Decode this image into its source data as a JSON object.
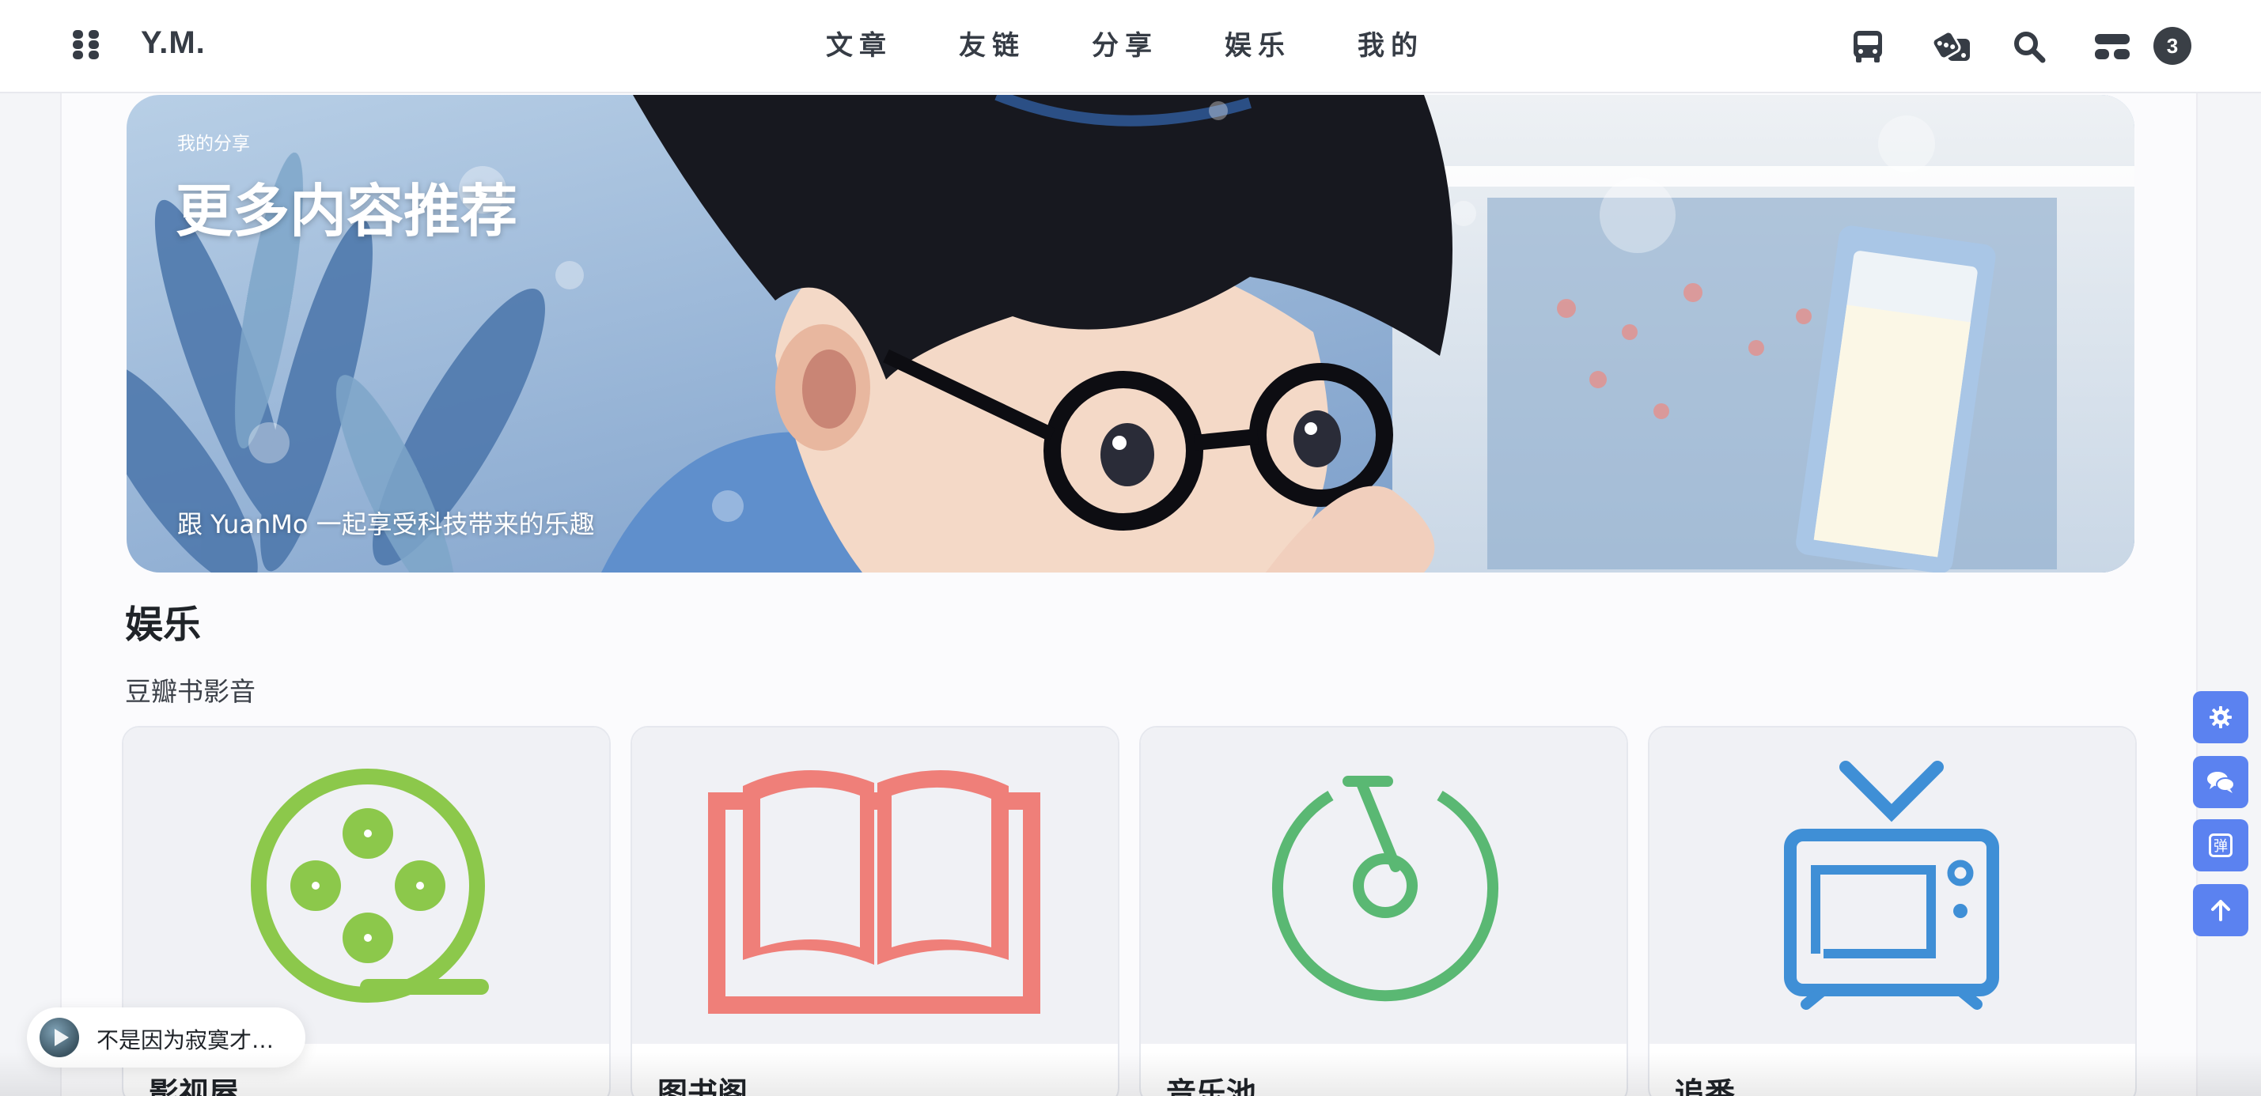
{
  "header": {
    "brand": "Y.M.",
    "nav": [
      "文章",
      "友链",
      "分享",
      "娱乐",
      "我的"
    ],
    "icons": [
      "bus-icon",
      "dice-icon",
      "search-icon",
      "toggle-icon"
    ],
    "badge": "3"
  },
  "banner": {
    "eyebrow": "我的分享",
    "title": "更多内容推荐",
    "subtitle": "跟 YuanMo 一起享受科技带来的乐趣"
  },
  "section": {
    "title": "娱乐",
    "subtitle": "豆瓣书影音"
  },
  "cards": [
    {
      "label": "影视屋",
      "icon": "film-reel-icon",
      "color": "#8cc84b"
    },
    {
      "label": "图书阁",
      "icon": "open-book-icon",
      "color": "#ef7f79"
    },
    {
      "label": "音乐池",
      "icon": "music-note-icon",
      "color": "#5ab873"
    },
    {
      "label": "追番",
      "icon": "tv-icon",
      "color": "#3f8fd6"
    }
  ],
  "floating": [
    "settings-icon",
    "chat-icon",
    "danmaku-icon",
    "arrow-up-icon"
  ],
  "floating_danmaku_label": "弹",
  "music": {
    "title": "不是因为寂寞才…"
  },
  "colors": {
    "accent": "#5b82f0",
    "text": "#363c45"
  }
}
